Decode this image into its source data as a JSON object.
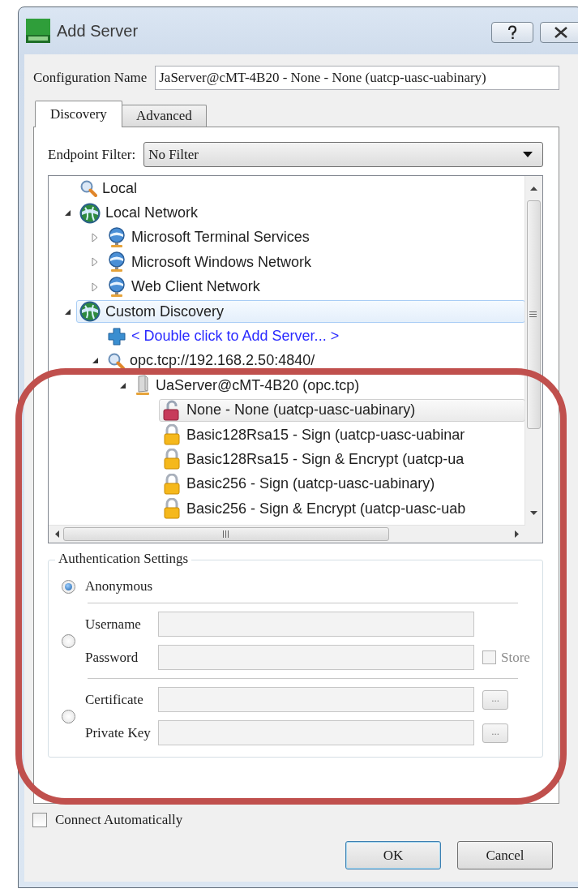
{
  "window": {
    "title": "Add Server"
  },
  "configuration_name": {
    "label": "Configuration Name",
    "value": "JaServer@cMT-4B20 - None - None (uatcp-uasc-uabinary)"
  },
  "tabs": [
    {
      "label": "Discovery",
      "selected": true
    },
    {
      "label": "Advanced",
      "selected": false
    }
  ],
  "endpoint_filter": {
    "label": "Endpoint Filter:",
    "value": "No Filter"
  },
  "tree": {
    "items": [
      {
        "kind": "search",
        "label": "Local",
        "selected": false
      },
      {
        "kind": "globe",
        "label": "Local Network",
        "expanded": true,
        "selected": false,
        "children": [
          {
            "kind": "network",
            "label": "Microsoft Terminal Services",
            "expanded": false,
            "selected": false
          },
          {
            "kind": "network",
            "label": "Microsoft Windows Network",
            "expanded": false,
            "selected": false
          },
          {
            "kind": "network",
            "label": "Web Client Network",
            "expanded": false,
            "selected": false
          }
        ]
      },
      {
        "kind": "globe",
        "label": "Custom Discovery",
        "expanded": true,
        "selected": true,
        "children": [
          {
            "kind": "add",
            "label": "< Double click to Add Server... >",
            "selected": false
          },
          {
            "kind": "search",
            "label": "opc.tcp://192.168.2.50:4840/",
            "expanded": true,
            "selected": false,
            "children": [
              {
                "kind": "server",
                "label": "UaServer@cMT-4B20 (opc.tcp)",
                "expanded": true,
                "selected": false,
                "children": [
                  {
                    "kind": "unlocked",
                    "label": "None - None (uatcp-uasc-uabinary)",
                    "selected": false,
                    "hot": true
                  },
                  {
                    "kind": "locked",
                    "label": "Basic128Rsa15 - Sign (uatcp-uasc-uabinar",
                    "selected": false,
                    "hot": false
                  },
                  {
                    "kind": "locked",
                    "label": "Basic128Rsa15 - Sign & Encrypt (uatcp-ua",
                    "selected": false,
                    "hot": false
                  },
                  {
                    "kind": "locked",
                    "label": "Basic256 - Sign (uatcp-uasc-uabinary)",
                    "selected": false,
                    "hot": false
                  },
                  {
                    "kind": "locked",
                    "label": "Basic256 - Sign & Encrypt (uatcp-uasc-uab",
                    "selected": false,
                    "hot": false
                  }
                ]
              }
            ]
          }
        ]
      }
    ]
  },
  "authentication": {
    "title": "Authentication Settings",
    "options": [
      {
        "kind": "anonymous",
        "selected": true,
        "label": "Anonymous"
      },
      {
        "kind": "user",
        "selected": false,
        "fields": [
          {
            "label": "Username",
            "disabled": true
          },
          {
            "label": "Password",
            "disabled": true
          }
        ],
        "store": {
          "label": "Store",
          "checked": false,
          "disabled": true
        }
      },
      {
        "kind": "certificate",
        "selected": false,
        "fields": [
          {
            "label": "Certificate",
            "disabled": true,
            "browse": "..."
          },
          {
            "label": "Private Key",
            "disabled": true,
            "browse": "..."
          }
        ]
      }
    ]
  },
  "connect_automatically": {
    "label": "Connect Automatically",
    "checked": false
  },
  "buttons": [
    {
      "label": "OK",
      "default": true
    },
    {
      "label": "Cancel",
      "default": false
    }
  ]
}
